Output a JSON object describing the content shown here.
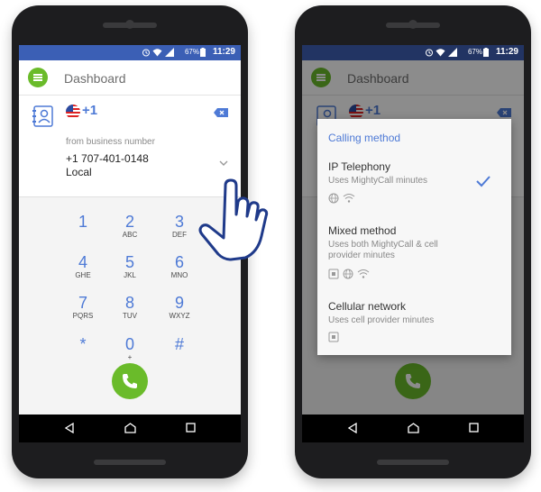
{
  "status_bar": {
    "time": "11:29",
    "battery": "67%"
  },
  "app_bar": {
    "title": "Dashboard"
  },
  "number_card": {
    "country_code": "+1",
    "from_label": "from business number",
    "phone_number": "+1 707-401-0148",
    "number_type": "Local"
  },
  "keypad": [
    {
      "digit": "1",
      "letters": ""
    },
    {
      "digit": "2",
      "letters": "ABC"
    },
    {
      "digit": "3",
      "letters": "DEF"
    },
    {
      "digit": "4",
      "letters": "GHE"
    },
    {
      "digit": "5",
      "letters": "JKL"
    },
    {
      "digit": "6",
      "letters": "MNO"
    },
    {
      "digit": "7",
      "letters": "PQRS"
    },
    {
      "digit": "8",
      "letters": "TUV"
    },
    {
      "digit": "9",
      "letters": "WXYZ"
    },
    {
      "digit": "*",
      "letters": ""
    },
    {
      "digit": "0",
      "letters": "+"
    },
    {
      "digit": "#",
      "letters": ""
    }
  ],
  "dialog": {
    "title": "Calling method",
    "options": [
      {
        "title": "IP Telephony",
        "desc": "Uses MightyCall minutes",
        "selected": true,
        "icons": [
          "globe-icon",
          "wifi-icon"
        ]
      },
      {
        "title": "Mixed method",
        "desc": "Uses both MightyCall & cell provider minutes",
        "selected": false,
        "icons": [
          "sim-icon",
          "globe-icon",
          "wifi-icon"
        ]
      },
      {
        "title": "Cellular network",
        "desc": "Uses cell provider minutes",
        "selected": false,
        "icons": [
          "sim-icon"
        ]
      }
    ]
  },
  "colors": {
    "accent_blue": "#4e7ad6",
    "brand_green": "#6abb2a",
    "status_blue": "#3b5fb5"
  }
}
